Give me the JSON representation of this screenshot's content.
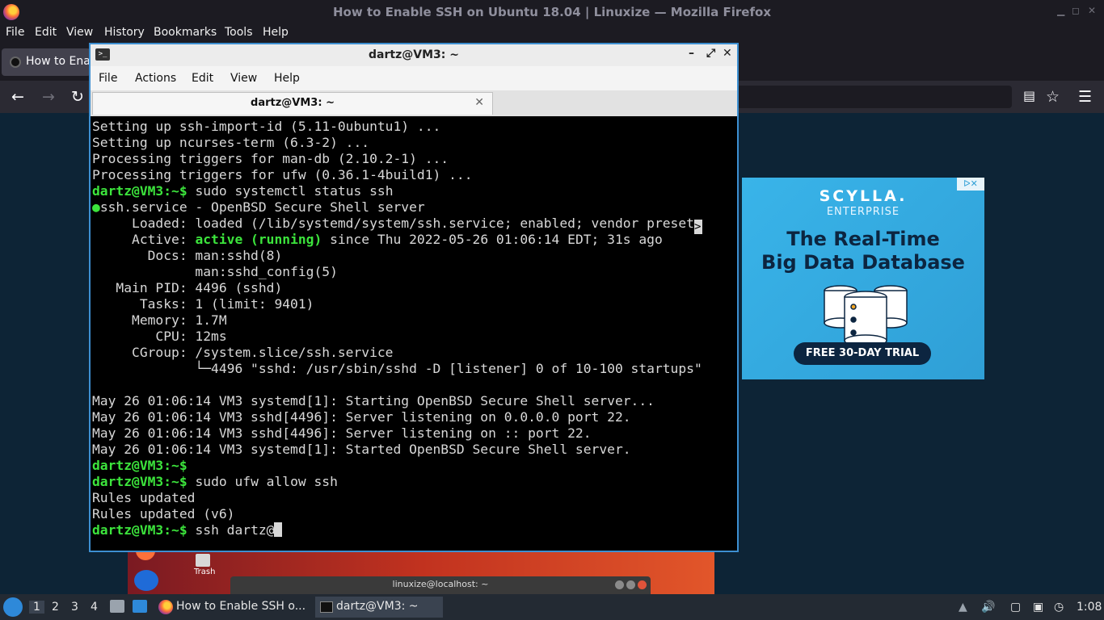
{
  "firefox": {
    "window_title": "How to Enable SSH on Ubuntu 18.04 | Linuxize — Mozilla Firefox",
    "menu": [
      "File",
      "Edit",
      "View",
      "History",
      "Bookmarks",
      "Tools",
      "Help"
    ],
    "tab_label": "How to Enal",
    "nav_icons": [
      "back-icon",
      "forward-icon",
      "reload-icon",
      "reader-view-icon",
      "bookmark-star-icon",
      "hamburger-menu-icon"
    ]
  },
  "ad": {
    "brand": "SCYLLA.",
    "subtitle": "ENTERPRISE",
    "headline_line1": "The Real-Time",
    "headline_line2": "Big Data Database",
    "cta": "FREE 30-DAY TRIAL",
    "close_glyph": "ᐅ✕"
  },
  "desktop": {
    "trash_label": "Trash",
    "background_window_title": "linuxize@localhost: ~"
  },
  "terminal": {
    "title": "dartz@VM3: ~",
    "menu": [
      "File",
      "Actions",
      "Edit",
      "View",
      "Help"
    ],
    "tab_label": "dartz@VM3: ~",
    "lines": [
      "Setting up ssh-import-id (5.11-0ubuntu1) ...",
      "Setting up ncurses-term (6.3-2) ...",
      "Processing triggers for man-db (2.10.2-1) ...",
      "Processing triggers for ufw (0.36.1-4build1) ..."
    ],
    "prompt_user": "dartz@VM3",
    "prompt_path": ":~$",
    "cmd1": " sudo systemctl status ssh",
    "service_line": "ssh.service - OpenBSD Secure Shell server",
    "loaded": "     Loaded: loaded (/lib/systemd/system/ssh.service; enabled; vendor preset",
    "active_pre": "     Active: ",
    "active_state": "active (running)",
    "active_post": " since Thu 2022-05-26 01:06:14 EDT; 31s ago",
    "docs1": "       Docs: man:sshd(8)",
    "docs2": "             man:sshd_config(5)",
    "mainpid": "   Main PID: 4496 (sshd)",
    "tasks": "      Tasks: 1 (limit: 9401)",
    "memory": "     Memory: 1.7M",
    "cpu": "        CPU: 12ms",
    "cgroup": "     CGroup: /system.slice/ssh.service",
    "cgroup_child": "             └─4496 \"sshd: /usr/sbin/sshd -D [listener] 0 of 10-100 startups\"",
    "log": [
      "May 26 01:06:14 VM3 systemd[1]: Starting OpenBSD Secure Shell server...",
      "May 26 01:06:14 VM3 sshd[4496]: Server listening on 0.0.0.0 port 22.",
      "May 26 01:06:14 VM3 sshd[4496]: Server listening on :: port 22.",
      "May 26 01:06:14 VM3 systemd[1]: Started OpenBSD Secure Shell server."
    ],
    "cmd2": " sudo ufw allow ssh",
    "out1": "Rules updated",
    "out2": "Rules updated (v6)",
    "cmd3": " ssh dartz@"
  },
  "taskbar": {
    "workspaces": [
      "1",
      "2",
      "3",
      "4"
    ],
    "task_firefox": "How to Enable SSH o...",
    "task_terminal": "dartz@VM3: ~",
    "clock": "1:08"
  }
}
